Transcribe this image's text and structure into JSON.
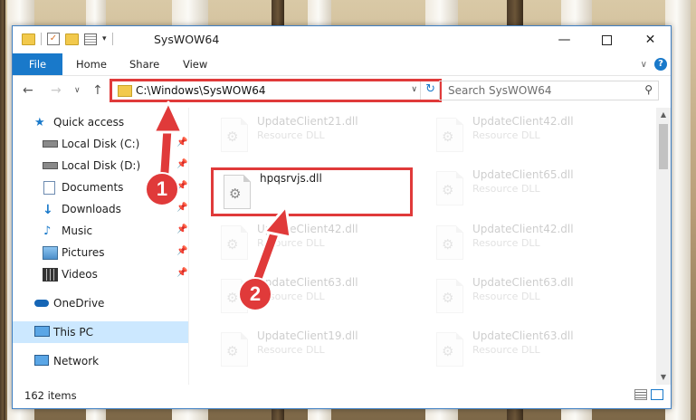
{
  "window": {
    "title": "SysWOW64"
  },
  "ribbon": {
    "tabs": [
      "File",
      "Home",
      "Share",
      "View"
    ]
  },
  "address": {
    "path": "C:\\Windows\\SysWOW64"
  },
  "search": {
    "placeholder": "Search SysWOW64"
  },
  "sidebar": {
    "items": [
      {
        "label": "Quick access",
        "icon": "star-icon",
        "pinned": false
      },
      {
        "label": "Local Disk (C:)",
        "icon": "drive-icon",
        "pinned": true
      },
      {
        "label": "Local Disk (D:)",
        "icon": "drive-icon",
        "pinned": true
      },
      {
        "label": "Documents",
        "icon": "documents-icon",
        "pinned": true
      },
      {
        "label": "Downloads",
        "icon": "downloads-icon",
        "pinned": true
      },
      {
        "label": "Music",
        "icon": "music-icon",
        "pinned": true
      },
      {
        "label": "Pictures",
        "icon": "pictures-icon",
        "pinned": true
      },
      {
        "label": "Videos",
        "icon": "videos-icon",
        "pinned": true
      },
      {
        "label": "OneDrive",
        "icon": "onedrive-icon",
        "pinned": false
      },
      {
        "label": "This PC",
        "icon": "computer-icon",
        "pinned": false,
        "selected": true
      },
      {
        "label": "Network",
        "icon": "network-icon",
        "pinned": false
      }
    ]
  },
  "files": [
    {
      "name": "UpdateClient21.dll",
      "type": "Resource DLL",
      "dim": true
    },
    {
      "name": "UpdateClient42.dll",
      "type": "Resource DLL",
      "dim": true
    },
    {
      "name": "hpqsrvjs.dll",
      "type": "",
      "dim": false,
      "highlighted": true
    },
    {
      "name": "UpdateClient65.dll",
      "type": "Resource DLL",
      "dim": true
    },
    {
      "name": "UpdateClient42.dll",
      "type": "Resource DLL",
      "dim": true
    },
    {
      "name": "UpdateClient42.dll",
      "type": "Resource DLL",
      "dim": true
    },
    {
      "name": "UpdateClient63.dll",
      "type": "Resource DLL",
      "dim": true
    },
    {
      "name": "UpdateClient63.dll",
      "type": "Resource DLL",
      "dim": true
    },
    {
      "name": "UpdateClient19.dll",
      "type": "Resource DLL",
      "dim": true
    },
    {
      "name": "UpdateClient63.dll",
      "type": "Resource DLL",
      "dim": true
    }
  ],
  "status": {
    "item_count": "162 items"
  },
  "annotations": {
    "step1": "1",
    "step2": "2",
    "color": "#e03a3a"
  },
  "colors": {
    "accent": "#1979ca",
    "selection": "#cce8ff"
  }
}
